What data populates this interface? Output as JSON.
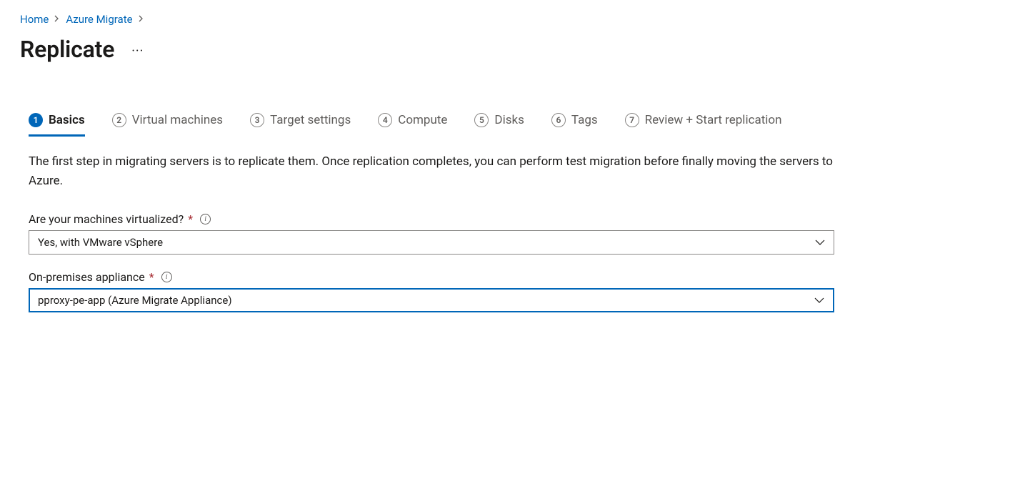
{
  "breadcrumb": {
    "home": "Home",
    "azure_migrate": "Azure Migrate"
  },
  "page_title": "Replicate",
  "steps": [
    {
      "num": "1",
      "label": "Basics"
    },
    {
      "num": "2",
      "label": "Virtual machines"
    },
    {
      "num": "3",
      "label": "Target settings"
    },
    {
      "num": "4",
      "label": "Compute"
    },
    {
      "num": "5",
      "label": "Disks"
    },
    {
      "num": "6",
      "label": "Tags"
    },
    {
      "num": "7",
      "label": "Review + Start replication"
    }
  ],
  "intro": "The first step in migrating servers is to replicate them. Once replication completes, you can perform test migration before finally moving the servers to Azure.",
  "fields": {
    "virtualized": {
      "label": "Are your machines virtualized?",
      "value": "Yes, with VMware vSphere"
    },
    "appliance": {
      "label": "On-premises appliance",
      "value": "pproxy-pe-app (Azure Migrate Appliance)"
    }
  }
}
